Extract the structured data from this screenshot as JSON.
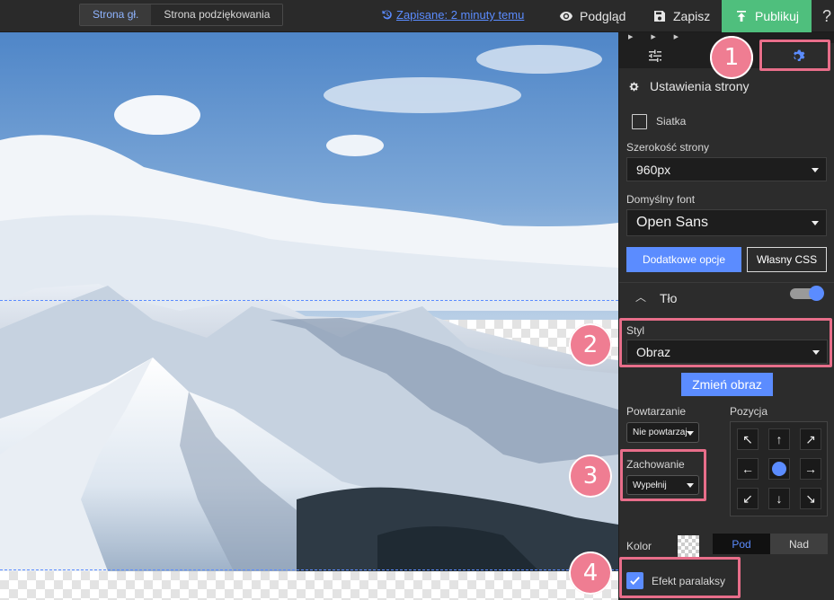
{
  "topbar": {
    "tabs": [
      {
        "label": "Strona gł.",
        "active": true
      },
      {
        "label": "Strona podziękowania",
        "active": false
      }
    ],
    "saved_status": "Zapisane: 2 minuty temu",
    "preview_label": "Podgląd",
    "save_label": "Zapisz",
    "publish_label": "Publikuj",
    "help_label": "?"
  },
  "panel": {
    "title": "Ustawienia strony",
    "grid_label": "Siatka",
    "grid_checked": false,
    "page_width_label": "Szerokość strony",
    "page_width_value": "960px",
    "default_font_label": "Domyślny font",
    "default_font_value": "Open Sans",
    "more_options_label": "Dodatkowe opcje",
    "custom_css_label": "Własny CSS",
    "background_section_label": "Tło",
    "background_enabled": true,
    "style_label": "Styl",
    "style_value": "Obraz",
    "change_image_label": "Zmień obraz",
    "repeat_label": "Powtarzanie",
    "repeat_value": "Nie powtarzaj",
    "position_label": "Pozycja",
    "behavior_label": "Zachowanie",
    "behavior_value": "Wypełnij",
    "color_label": "Kolor",
    "layer_options": [
      "Pod",
      "Nad"
    ],
    "layer_selected": "Pod",
    "parallax_label": "Efekt paralaksy",
    "parallax_checked": true
  },
  "callouts": [
    "1",
    "2",
    "3",
    "4"
  ],
  "colors": {
    "accent": "#5b8cff",
    "publish": "#4fbf7d",
    "highlight": "#e86e8a",
    "badge": "#ef7d92"
  }
}
